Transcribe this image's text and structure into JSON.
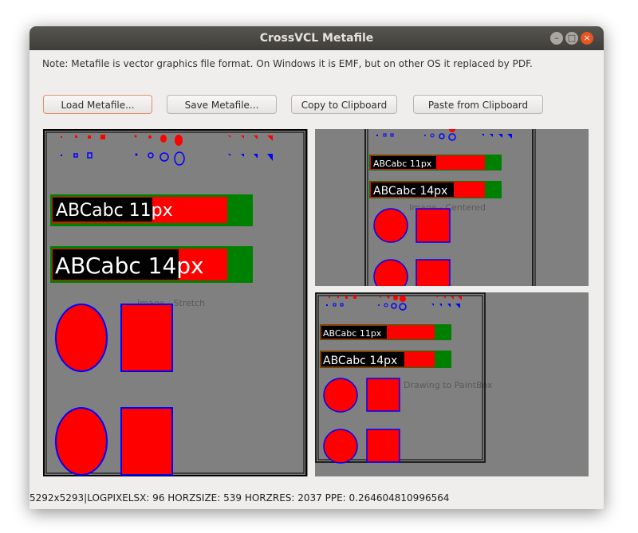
{
  "window": {
    "title": "CrossVCL Metafile",
    "controls": {
      "minimize_icon": "–",
      "maximize_icon": "□",
      "close_icon": "×"
    }
  },
  "note": "Note: Metafile is vector graphics file format. On Windows it is EMF, but on other OS it replaced by PDF.",
  "buttons": {
    "load": "Load Metafile...",
    "save": "Save Metafile...",
    "copy": "Copy to Clipboard",
    "paste": "Paste from Clipboard"
  },
  "panels": {
    "stretch": {
      "caption": "Image - Stretch"
    },
    "centered": {
      "caption": "Image - Centered"
    },
    "paintbox": {
      "caption": "Drawing to PaintBox"
    }
  },
  "drawing": {
    "text_small": "ABCabc 11px",
    "text_large": "ABCabc 14px",
    "colors": {
      "background": "#808080",
      "red": "#ff0000",
      "green": "#008000",
      "blue": "#0000ff",
      "black": "#000000",
      "white": "#ffffff"
    }
  },
  "status": "5292x5293|LOGPIXELSX: 96 HORZSIZE: 539 HORZRES: 2037 PPE: 0.264604810996564"
}
